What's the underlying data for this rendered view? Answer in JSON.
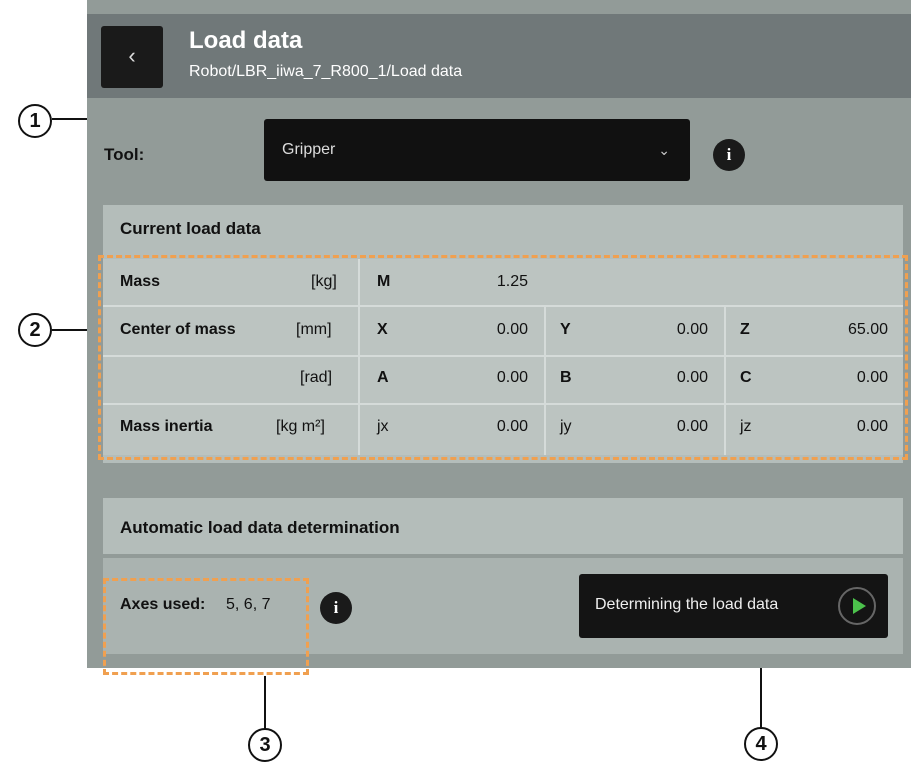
{
  "header": {
    "back_icon": "chevron-left",
    "title": "Load data",
    "breadcrumb": "Robot/LBR_iiwa_7_R800_1/Load data"
  },
  "tool": {
    "label": "Tool:",
    "selected": "Gripper",
    "dropdown_icon": "chevron-down"
  },
  "current": {
    "title": "Current load data",
    "mass": {
      "label": "Mass",
      "unit": "[kg]",
      "key": "M",
      "value": "1.25"
    },
    "com": {
      "label": "Center of mass",
      "unit": "[mm]",
      "x_key": "X",
      "x": "0.00",
      "y_key": "Y",
      "y": "0.00",
      "z_key": "Z",
      "z": "65.00"
    },
    "rot": {
      "unit": "[rad]",
      "a_key": "A",
      "a": "0.00",
      "b_key": "B",
      "b": "0.00",
      "c_key": "C",
      "c": "0.00"
    },
    "inertia": {
      "label": "Mass inertia",
      "unit": "[kg m²]",
      "jx_key": "jx",
      "jx": "0.00",
      "jy_key": "jy",
      "jy": "0.00",
      "jz_key": "jz",
      "jz": "0.00"
    }
  },
  "auto": {
    "title": "Automatic load data determination",
    "axes_label": "Axes used:",
    "axes_value": "5, 6, 7",
    "button_label": "Determining the load data"
  },
  "callouts": [
    "1",
    "2",
    "3",
    "4"
  ],
  "colors": {
    "highlight": "#f0a050",
    "play": "#4cc24c"
  }
}
